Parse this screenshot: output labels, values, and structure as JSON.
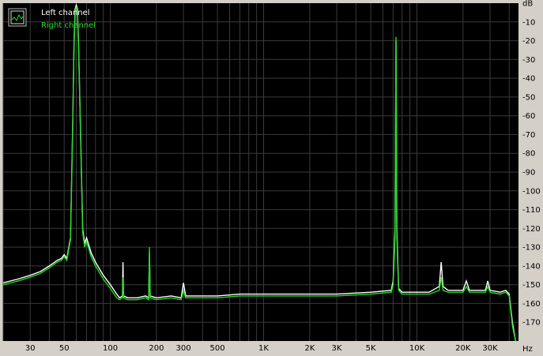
{
  "chart_data": {
    "type": "line",
    "title": "",
    "xlabel": "Hz",
    "ylabel": "dB",
    "x_scale": "log",
    "xlim": [
      20,
      46000
    ],
    "ylim": [
      -180,
      0
    ],
    "grid": true,
    "legend_position": "top-left",
    "colors": {
      "background": "#000000",
      "frame": "#d4d0c8",
      "grid": "#3a3a3a",
      "left_channel": "#ffffff",
      "right_channel": "#22dd22"
    },
    "y_ticks": [
      "dB",
      "-10",
      "-20",
      "-30",
      "-40",
      "-50",
      "-60",
      "-70",
      "-80",
      "-90",
      "-100",
      "-110",
      "-120",
      "-130",
      "-140",
      "-150",
      "-160",
      "-170"
    ],
    "x_ticks": [
      {
        "label": "30",
        "value": 30
      },
      {
        "label": "50",
        "value": 50
      },
      {
        "label": "100",
        "value": 100
      },
      {
        "label": "200",
        "value": 200
      },
      {
        "label": "300",
        "value": 300
      },
      {
        "label": "500",
        "value": 500
      },
      {
        "label": "1K",
        "value": 1000
      },
      {
        "label": "2K",
        "value": 2000
      },
      {
        "label": "3K",
        "value": 3000
      },
      {
        "label": "5K",
        "value": 5000
      },
      {
        "label": "10K",
        "value": 10000
      },
      {
        "label": "20K",
        "value": 20000
      },
      {
        "label": "30K",
        "value": 30000
      }
    ],
    "x_unit": "Hz",
    "series": [
      {
        "name": "Left channel",
        "color": "#ffffff",
        "points": [
          [
            20,
            -149
          ],
          [
            25,
            -147
          ],
          [
            30,
            -145
          ],
          [
            35,
            -143
          ],
          [
            40,
            -140
          ],
          [
            45,
            -137
          ],
          [
            48,
            -136
          ],
          [
            50,
            -134
          ],
          [
            52,
            -136
          ],
          [
            55,
            -125
          ],
          [
            57,
            -60
          ],
          [
            58,
            -20
          ],
          [
            59,
            -3
          ],
          [
            60,
            -1
          ],
          [
            61,
            -3
          ],
          [
            62,
            -20
          ],
          [
            64,
            -70
          ],
          [
            66,
            -120
          ],
          [
            68,
            -128
          ],
          [
            70,
            -125
          ],
          [
            75,
            -133
          ],
          [
            80,
            -138
          ],
          [
            90,
            -145
          ],
          [
            100,
            -150
          ],
          [
            110,
            -155
          ],
          [
            115,
            -157
          ],
          [
            120,
            -156
          ],
          [
            121,
            -138
          ],
          [
            122,
            -156
          ],
          [
            130,
            -157
          ],
          [
            150,
            -157
          ],
          [
            170,
            -156
          ],
          [
            178,
            -157
          ],
          [
            180,
            -133
          ],
          [
            182,
            -156
          ],
          [
            200,
            -157
          ],
          [
            250,
            -156
          ],
          [
            290,
            -157
          ],
          [
            300,
            -149
          ],
          [
            310,
            -156
          ],
          [
            400,
            -156
          ],
          [
            500,
            -156
          ],
          [
            700,
            -155
          ],
          [
            1000,
            -155
          ],
          [
            2000,
            -155
          ],
          [
            3000,
            -155
          ],
          [
            5000,
            -154
          ],
          [
            6800,
            -153
          ],
          [
            7000,
            -148
          ],
          [
            7200,
            -120
          ],
          [
            7300,
            -20
          ],
          [
            7400,
            -120
          ],
          [
            7600,
            -152
          ],
          [
            8000,
            -154
          ],
          [
            10000,
            -154
          ],
          [
            12000,
            -154
          ],
          [
            14000,
            -151
          ],
          [
            14400,
            -138
          ],
          [
            14800,
            -151
          ],
          [
            16000,
            -153
          ],
          [
            20000,
            -153
          ],
          [
            21000,
            -148
          ],
          [
            22000,
            -153
          ],
          [
            25000,
            -153
          ],
          [
            28000,
            -153
          ],
          [
            29000,
            -148
          ],
          [
            30000,
            -153
          ],
          [
            35000,
            -154
          ],
          [
            38000,
            -153
          ],
          [
            40000,
            -155
          ],
          [
            42000,
            -170
          ],
          [
            44000,
            -180
          ]
        ]
      },
      {
        "name": "Right channel",
        "color": "#22dd22",
        "points": [
          [
            20,
            -150
          ],
          [
            25,
            -148
          ],
          [
            30,
            -146
          ],
          [
            35,
            -144
          ],
          [
            40,
            -141
          ],
          [
            45,
            -138
          ],
          [
            48,
            -137
          ],
          [
            50,
            -135
          ],
          [
            52,
            -137
          ],
          [
            55,
            -126
          ],
          [
            57,
            -62
          ],
          [
            58,
            -22
          ],
          [
            59,
            -5
          ],
          [
            60,
            -2
          ],
          [
            61,
            -5
          ],
          [
            62,
            -22
          ],
          [
            64,
            -72
          ],
          [
            66,
            -122
          ],
          [
            68,
            -130
          ],
          [
            70,
            -127
          ],
          [
            75,
            -135
          ],
          [
            80,
            -140
          ],
          [
            90,
            -147
          ],
          [
            100,
            -152
          ],
          [
            110,
            -157
          ],
          [
            115,
            -158
          ],
          [
            120,
            -157
          ],
          [
            121,
            -146
          ],
          [
            122,
            -157
          ],
          [
            130,
            -158
          ],
          [
            150,
            -158
          ],
          [
            170,
            -157
          ],
          [
            178,
            -158
          ],
          [
            180,
            -130
          ],
          [
            182,
            -157
          ],
          [
            200,
            -158
          ],
          [
            250,
            -157
          ],
          [
            290,
            -158
          ],
          [
            300,
            -153
          ],
          [
            310,
            -157
          ],
          [
            400,
            -157
          ],
          [
            500,
            -157
          ],
          [
            700,
            -156
          ],
          [
            1000,
            -156
          ],
          [
            2000,
            -156
          ],
          [
            3000,
            -156
          ],
          [
            5000,
            -155
          ],
          [
            6800,
            -154
          ],
          [
            7000,
            -150
          ],
          [
            7200,
            -125
          ],
          [
            7300,
            -18
          ],
          [
            7400,
            -125
          ],
          [
            7600,
            -153
          ],
          [
            8000,
            -155
          ],
          [
            10000,
            -155
          ],
          [
            12000,
            -155
          ],
          [
            14000,
            -153
          ],
          [
            14400,
            -146
          ],
          [
            14800,
            -153
          ],
          [
            16000,
            -154
          ],
          [
            20000,
            -154
          ],
          [
            21000,
            -151
          ],
          [
            22000,
            -154
          ],
          [
            25000,
            -154
          ],
          [
            28000,
            -154
          ],
          [
            29000,
            -151
          ],
          [
            30000,
            -154
          ],
          [
            35000,
            -155
          ],
          [
            38000,
            -154
          ],
          [
            40000,
            -156
          ],
          [
            42000,
            -172
          ],
          [
            44000,
            -180
          ]
        ]
      }
    ]
  }
}
